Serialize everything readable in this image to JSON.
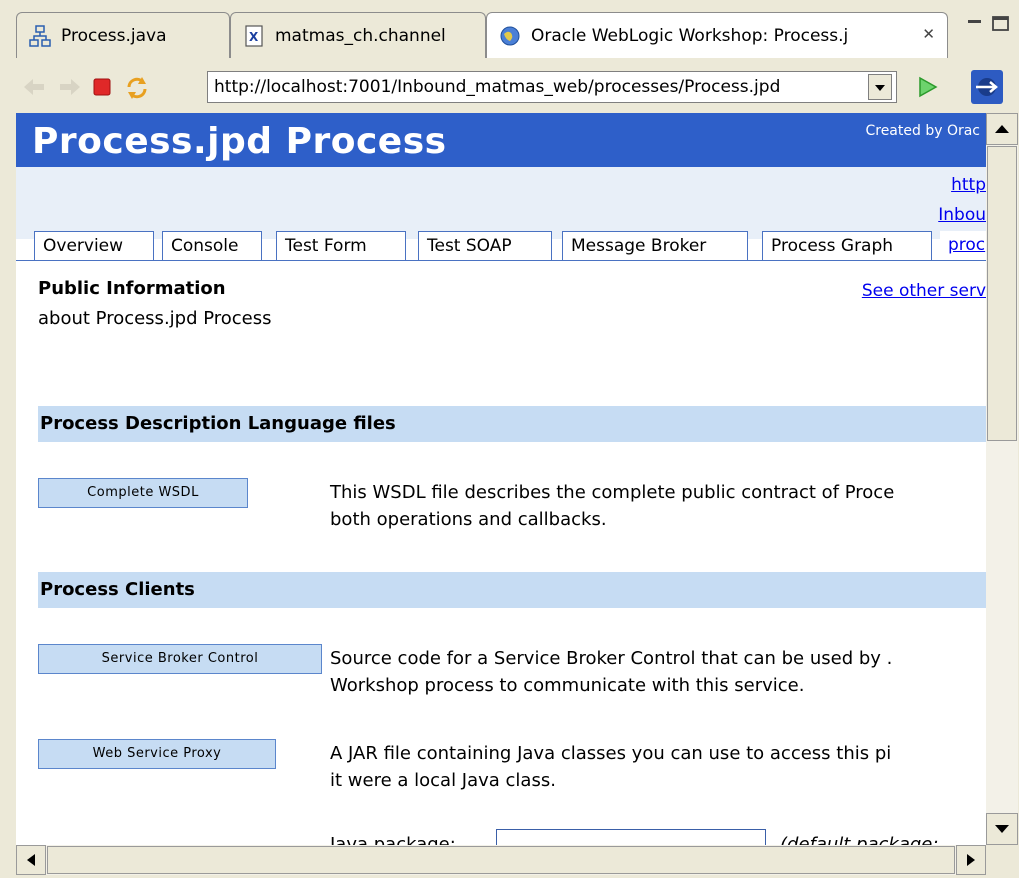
{
  "editor_tabs": [
    {
      "label": "Process.java",
      "icon": "process-icon"
    },
    {
      "label": "matmas_ch.channel",
      "icon": "x-file-icon"
    },
    {
      "label": "Oracle WebLogic Workshop: Process.j",
      "icon": "globe-icon"
    }
  ],
  "toolbar": {
    "url": "http://localhost:7001/Inbound_matmas_web/processes/Process.jpd"
  },
  "page": {
    "title": "Process.jpd Process",
    "created_by": "Created by Orac",
    "right_link_1": "http",
    "right_link_2": "Inbou",
    "tabs": [
      "Overview",
      "Console",
      "Test Form",
      "Test SOAP",
      "Message Broker",
      "Process Graph",
      "proc"
    ],
    "public_info_heading": "Public Information",
    "public_info_sub": "about Process.jpd Process",
    "see_other": "See other serv",
    "section_pdl": "Process Description Language files",
    "btn_wsdl": "Complete WSDL",
    "wsdl_desc_1": "This WSDL file describes the complete public contract of Proce",
    "wsdl_desc_2": "both operations and callbacks.",
    "section_clients": "Process Clients",
    "btn_sbc": "Service Broker Control",
    "sbc_desc_1": "Source code for a Service Broker Control that can be used by .",
    "sbc_desc_2": "Workshop process to communicate with this service.",
    "btn_proxy": "Web Service Proxy",
    "proxy_desc_1": "A JAR file containing Java classes you can use to access this pi",
    "proxy_desc_2": "it were a local Java class.",
    "java_package_label": "Java package:",
    "default_package": "(default package;"
  },
  "colors": {
    "banner": "#2e5fc9",
    "section": "#c6dcf3",
    "link": "#0000ee"
  }
}
